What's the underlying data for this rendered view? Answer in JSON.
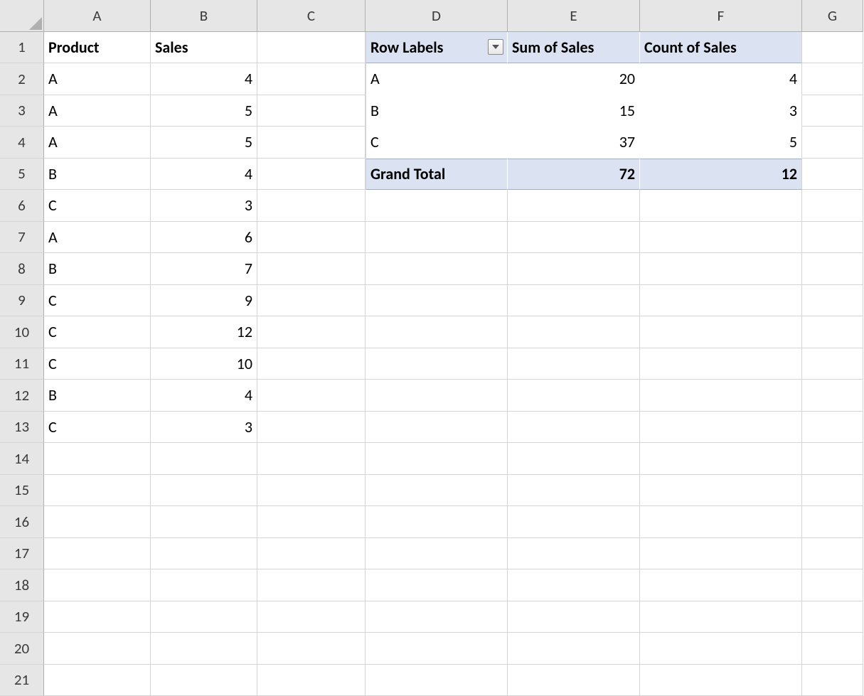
{
  "columns": [
    "A",
    "B",
    "C",
    "D",
    "E",
    "F",
    "G"
  ],
  "row_count": 21,
  "source_table": {
    "headers": {
      "product": "Product",
      "sales": "Sales"
    },
    "rows": [
      {
        "product": "A",
        "sales": 4
      },
      {
        "product": "A",
        "sales": 5
      },
      {
        "product": "A",
        "sales": 5
      },
      {
        "product": "B",
        "sales": 4
      },
      {
        "product": "C",
        "sales": 3
      },
      {
        "product": "A",
        "sales": 6
      },
      {
        "product": "B",
        "sales": 7
      },
      {
        "product": "C",
        "sales": 9
      },
      {
        "product": "C",
        "sales": 12
      },
      {
        "product": "C",
        "sales": 10
      },
      {
        "product": "B",
        "sales": 4
      },
      {
        "product": "C",
        "sales": 3
      }
    ]
  },
  "pivot_table": {
    "headers": {
      "row_labels": "Row Labels",
      "sum": "Sum of Sales",
      "count": "Count of Sales"
    },
    "rows": [
      {
        "label": "A",
        "sum": 20,
        "count": 4
      },
      {
        "label": "B",
        "sum": 15,
        "count": 3
      },
      {
        "label": "C",
        "sum": 37,
        "count": 5
      }
    ],
    "total": {
      "label": "Grand Total",
      "sum": 72,
      "count": 12
    }
  }
}
